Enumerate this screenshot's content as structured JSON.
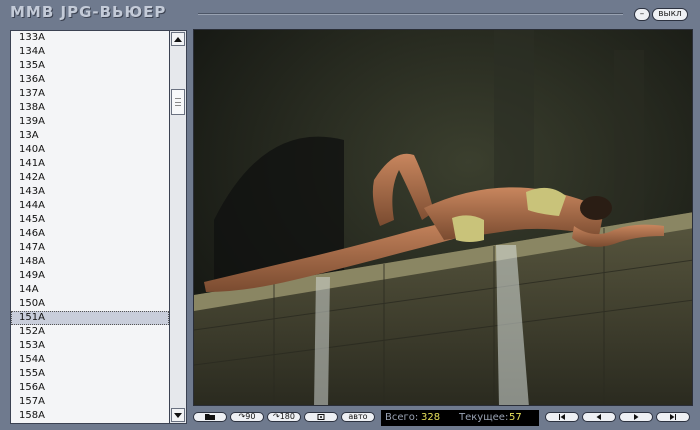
{
  "app": {
    "title": "MMB JPG-ВЬЮЕР",
    "minimize_label": "–",
    "exit_label": "выкл"
  },
  "file_list": {
    "items": [
      "133A",
      "134A",
      "135A",
      "136A",
      "137A",
      "138A",
      "139A",
      "13A",
      "140A",
      "141A",
      "142A",
      "143A",
      "144A",
      "145A",
      "146A",
      "147A",
      "148A",
      "149A",
      "14A",
      "150A",
      "151A",
      "152A",
      "153A",
      "154A",
      "155A",
      "156A",
      "157A",
      "158A"
    ],
    "selected": "151A"
  },
  "toolbar": {
    "rotate90_label": "↷90",
    "rotate180_label": "↷180",
    "auto_label": "авто"
  },
  "status": {
    "total_label": "Всего:",
    "total_value": "328",
    "current_label": "Текущее:",
    "current_value": "57"
  },
  "colors": {
    "background": "#6f7a8e",
    "list_bg": "#f4f5f7",
    "counter_value": "#e6e05a",
    "counter_label": "#9aa3b4"
  }
}
